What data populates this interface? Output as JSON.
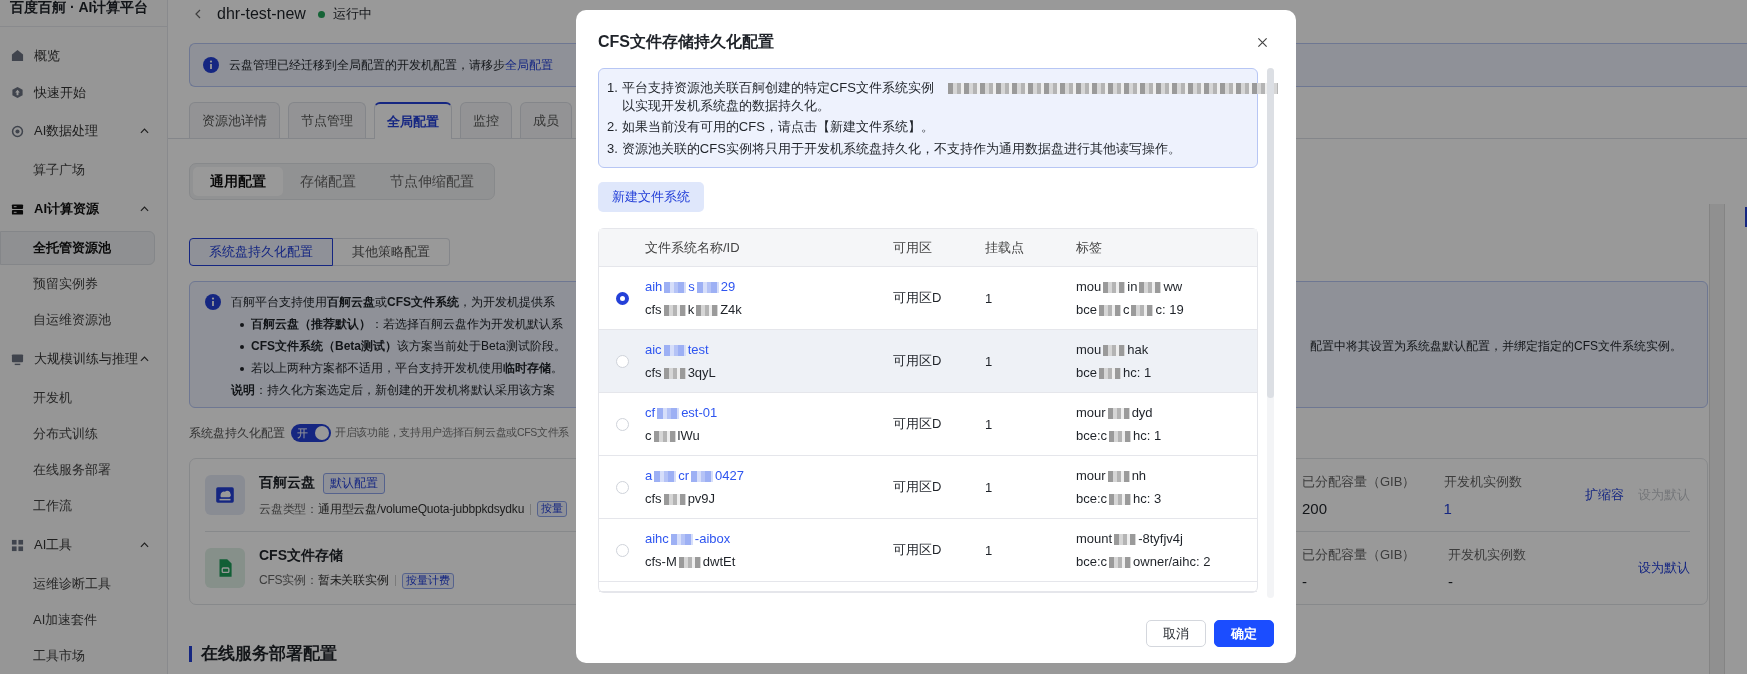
{
  "sidebar": {
    "title": "百度百舸 · AI计算平台",
    "items": [
      {
        "kind": "link",
        "label": "概览"
      },
      {
        "kind": "link",
        "label": "快速开始"
      },
      {
        "kind": "group",
        "label": "AI数据处理",
        "expanded": true,
        "active": false,
        "children": [
          {
            "label": "算子广场",
            "selected": false
          }
        ]
      },
      {
        "kind": "group",
        "label": "AI计算资源",
        "expanded": true,
        "active": true,
        "children": [
          {
            "label": "全托管资源池",
            "selected": true
          },
          {
            "label": "预留实例券",
            "selected": false
          },
          {
            "label": "自运维资源池",
            "selected": false
          }
        ]
      },
      {
        "kind": "group",
        "label": "大规模训练与推理",
        "expanded": true,
        "active": false,
        "children": [
          {
            "label": "开发机",
            "selected": false
          },
          {
            "label": "分布式训练",
            "selected": false
          },
          {
            "label": "在线服务部署",
            "selected": false
          },
          {
            "label": "工作流",
            "selected": false
          }
        ]
      },
      {
        "kind": "group",
        "label": "AI工具",
        "expanded": true,
        "active": false,
        "children": [
          {
            "label": "运维诊断工具",
            "selected": false
          },
          {
            "label": "AI加速套件",
            "selected": false
          },
          {
            "label": "工具市场",
            "selected": false
          }
        ]
      }
    ]
  },
  "header": {
    "title": "dhr-test-new",
    "status": "运行中",
    "running": true
  },
  "notice": {
    "text": "云盘管理已经迁移到全局配置的开发机配置，请移步",
    "link": "全局配置"
  },
  "tabs": [
    {
      "label": "资源池详情",
      "selected": false
    },
    {
      "label": "节点管理",
      "selected": false
    },
    {
      "label": "全局配置",
      "selected": true
    },
    {
      "label": "监控",
      "selected": false
    },
    {
      "label": "成员",
      "selected": false
    }
  ],
  "segments": [
    {
      "label": "通用配置",
      "selected": true
    },
    {
      "label": "存储配置",
      "selected": false
    },
    {
      "label": "节点伸缩配置",
      "selected": false
    }
  ],
  "sub_tabs": [
    {
      "label": "系统盘持久化配置",
      "selected": true
    },
    {
      "label": "其他策略配置",
      "selected": false
    }
  ],
  "info": {
    "lead": "百舸平台支持使用**百舸云盘**或**CFS文件系统**，为开发机提供系",
    "bullets": [
      {
        "text": "**百舸云盘（推荐默认）**：若选择百舸云盘作为开发机默认系"
      },
      {
        "text": "**CFS文件系统（Beta测试）**该方案当前处于Beta测试阶段。",
        "tail": "配置中将其设置为系统盘默认配置，并绑定指定的CFS文件系统实例。"
      },
      {
        "text": "若以上两种方案都不适用，平台支持开发机使用**临时存储**。"
      }
    ],
    "note": "**说明**：持久化方案选定后，新创建的开发机将默认采用该方案"
  },
  "persistence": {
    "label": "系统盘持久化配置",
    "on": true,
    "switch_text": "开",
    "hint": "开启该功能，支持用户选择百舸云盘或CFS文件系"
  },
  "storages": [
    {
      "kind": "disk",
      "name": "百舸云盘",
      "badge": "默认配置",
      "detail_label": "云盘类型：",
      "detail": "通用型云盘/volumeQuota-jubbpkdsydku",
      "billing": "按量",
      "capacity_label": "已分配容量（GIB）",
      "capacity": "200",
      "instances_label": "开发机实例数",
      "instances": "1",
      "instances_linked": true,
      "actions": [
        {
          "label": "扩缩容",
          "disabled": false
        },
        {
          "label": "设为默认",
          "disabled": true
        }
      ]
    },
    {
      "kind": "cfs",
      "name": "CFS文件存储",
      "detail_label": "CFS实例：",
      "detail": "暂未关联实例",
      "billing": "按量计费",
      "capacity_label": "已分配容量（GIB）",
      "capacity": "-",
      "instances_label": "开发机实例数",
      "instances": "-",
      "instances_linked": false,
      "actions": [
        {
          "label": "设为默认",
          "disabled": false
        }
      ]
    }
  ],
  "section_title": "在线服务部署配置",
  "dialog": {
    "title": "CFS文件存储持久化配置",
    "notes": [
      {
        "number": "1.",
        "text": "平台支持资源池关联百舸创建的特定CFS文件系统实例",
        "redacted": true,
        "continuation": "以实现开发机系统盘的数据持久化。"
      },
      {
        "number": "2.",
        "text": "如果当前没有可用的CFS，请点击【新建文件系统】。",
        "redacted": false
      },
      {
        "number": "3.",
        "text": "资源池关联的CFS实例将只用于开发机系统盘持久化，不支持作为通用数据盘进行其他读写操作。",
        "redacted": false
      }
    ],
    "new_button": "新建文件系统",
    "columns": [
      "文件系统名称/ID",
      "可用区",
      "挂载点",
      "标签"
    ],
    "rows": [
      {
        "selected": true,
        "highlighted": false,
        "name_parts": [
          "aih",
          "s",
          "29"
        ],
        "id_parts": [
          "cfs",
          "k",
          "Z4k"
        ],
        "zone": "可用区D",
        "mounts": "1",
        "tag_lines": [
          [
            "mou",
            "in",
            "ww"
          ],
          [
            "bce",
            "c",
            "c: 19"
          ]
        ]
      },
      {
        "selected": false,
        "highlighted": true,
        "name_parts": [
          "aic",
          "test"
        ],
        "id_parts": [
          "cfs",
          "3qyL"
        ],
        "zone": "可用区D",
        "mounts": "1",
        "tag_lines": [
          [
            "mou",
            "hak"
          ],
          [
            "bce",
            "hc: 1"
          ]
        ]
      },
      {
        "selected": false,
        "highlighted": false,
        "name_parts": [
          "cf",
          "est-01"
        ],
        "id_parts": [
          "c",
          "lWu"
        ],
        "zone": "可用区D",
        "mounts": "1",
        "tag_lines": [
          [
            "mour",
            "dyd"
          ],
          [
            "bce:c",
            "hc: 1"
          ]
        ]
      },
      {
        "selected": false,
        "highlighted": false,
        "name_parts": [
          "a",
          "cr",
          "0427"
        ],
        "id_parts": [
          "cfs",
          "pv9J"
        ],
        "zone": "可用区D",
        "mounts": "1",
        "tag_lines": [
          [
            "mour",
            "nh"
          ],
          [
            "bce:c",
            "hc: 3"
          ]
        ]
      },
      {
        "selected": false,
        "highlighted": false,
        "name_parts": [
          "aihc",
          "-aibox"
        ],
        "id_parts": [
          "cfs-M",
          "dwtEt"
        ],
        "zone": "可用区D",
        "mounts": "1",
        "tag_lines": [
          [
            "mount",
            "-8tyfjv4j"
          ],
          [
            "bce:c",
            "owner/aihc: 2"
          ]
        ]
      }
    ],
    "buttons": [
      {
        "label": "取消",
        "kind": "secondary"
      },
      {
        "label": "确定",
        "kind": "primary"
      }
    ]
  }
}
